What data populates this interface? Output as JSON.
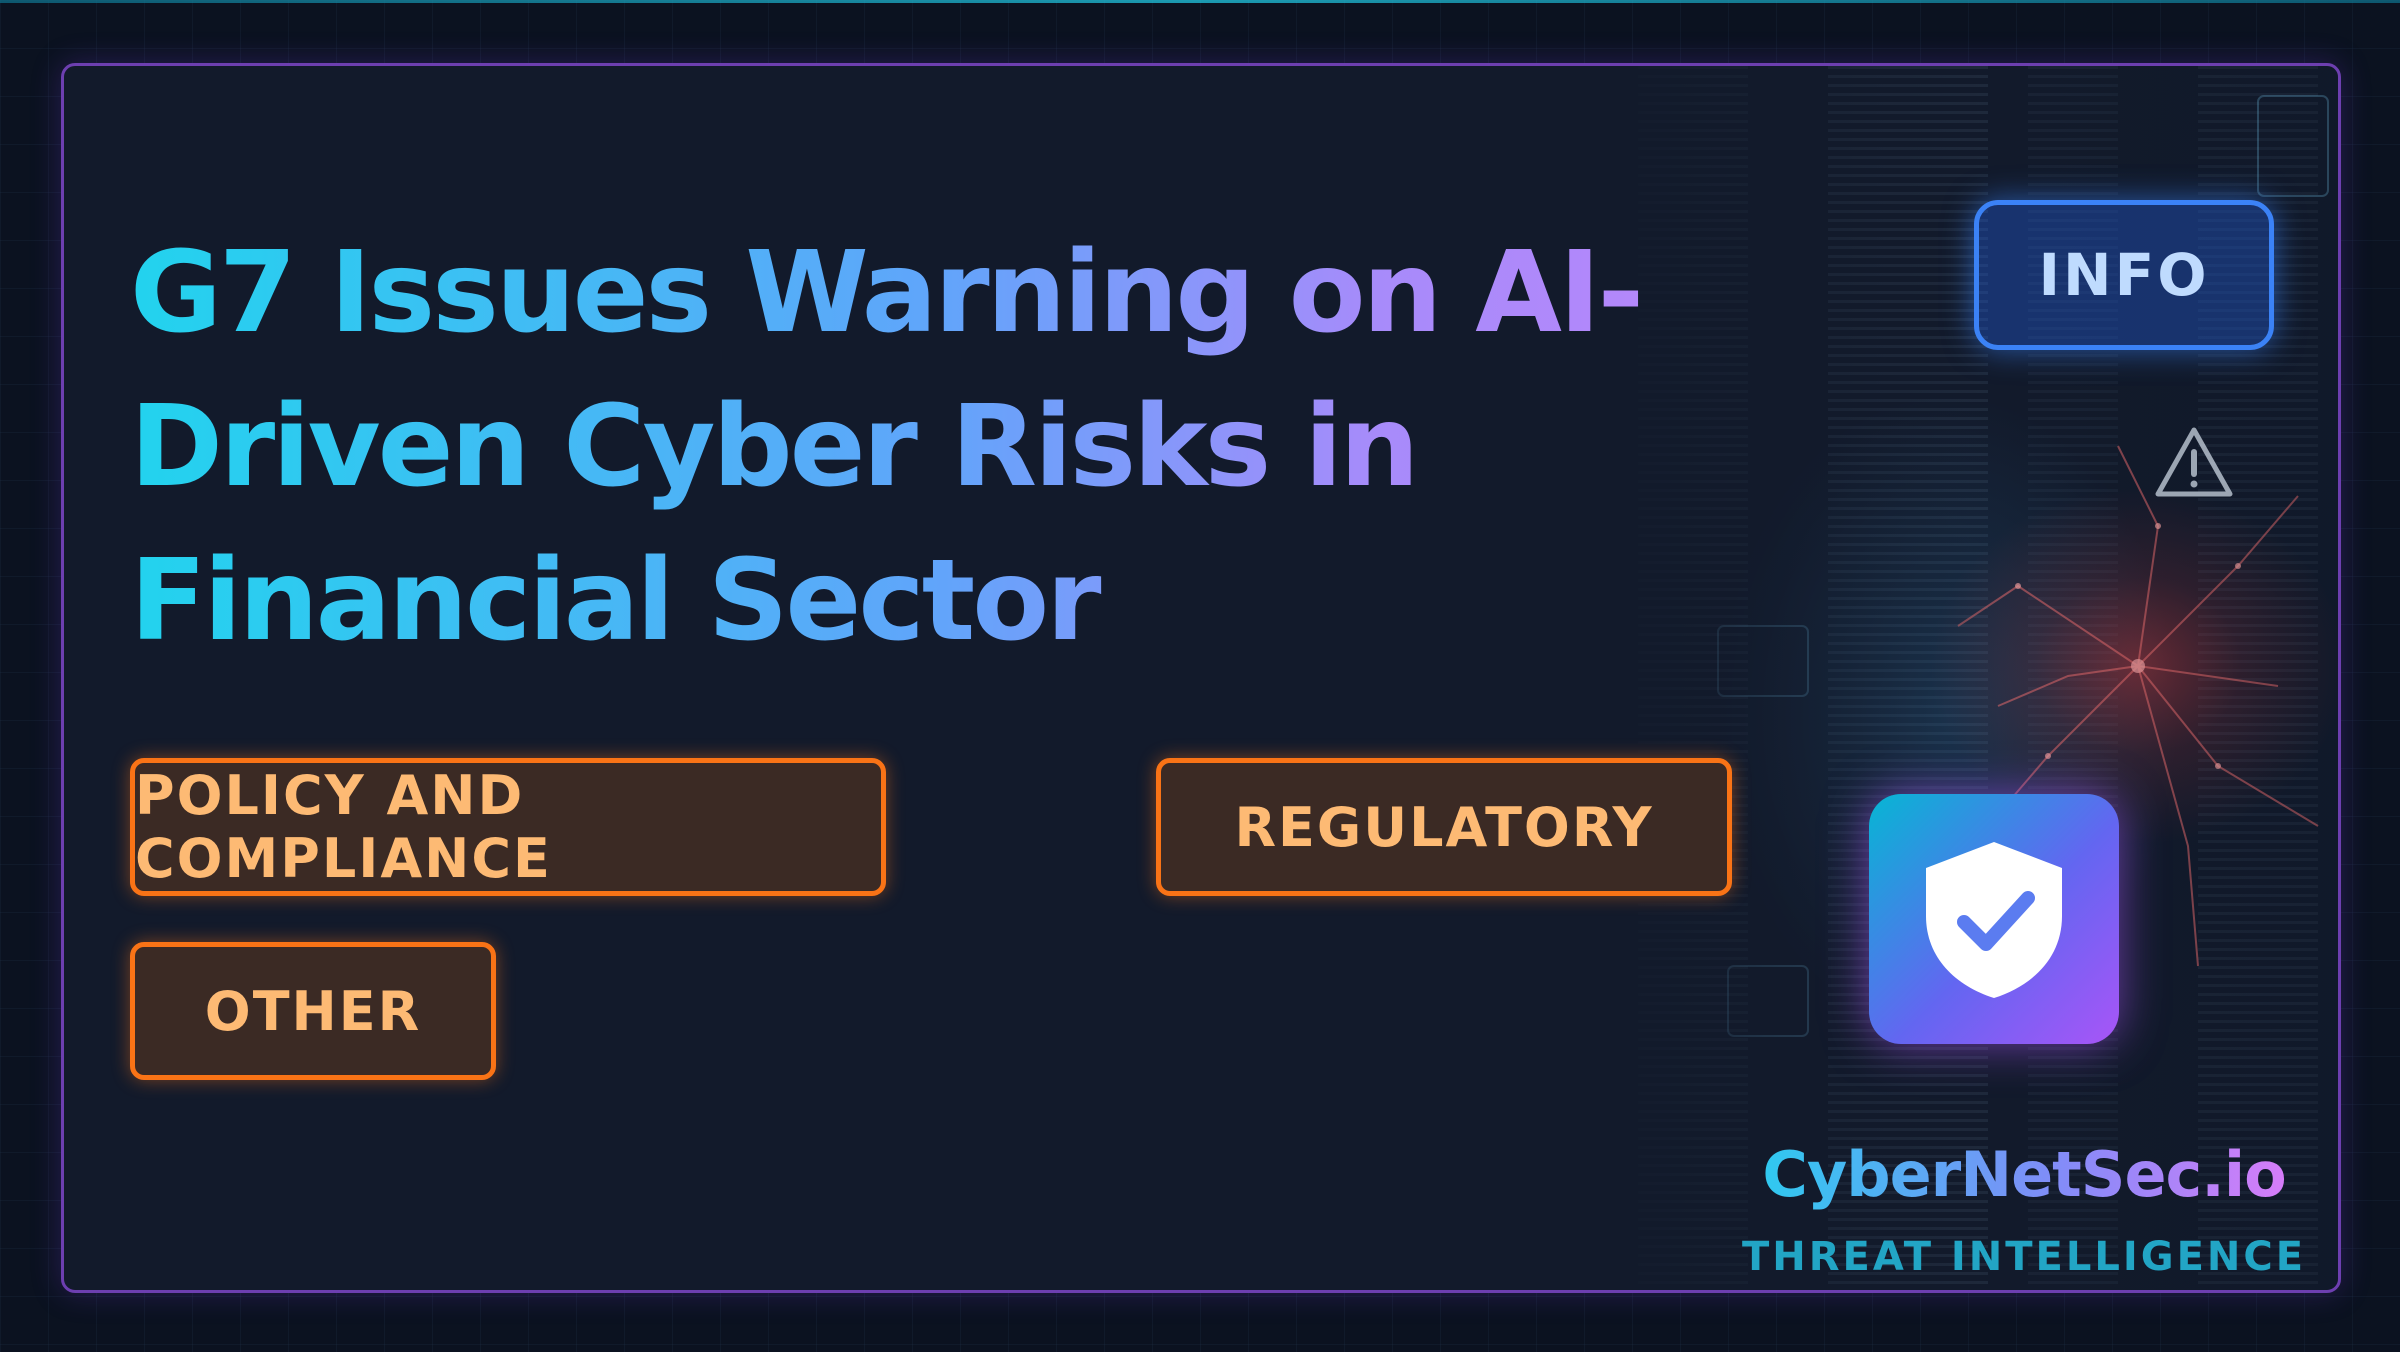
{
  "headline": {
    "line1": "G7 Issues Warning on AI-",
    "line2": "Driven Cyber Risks in",
    "line3": "Financial Sector"
  },
  "tags": [
    {
      "label": "POLICY AND COMPLIANCE"
    },
    {
      "label": "REGULATORY"
    },
    {
      "label": "OTHER"
    }
  ],
  "severity_badge": {
    "label": "INFO",
    "color": "#3b82f6"
  },
  "brand": {
    "name": "CyberNetSec.io",
    "tagline": "THREAT INTELLIGENCE",
    "icon": "shield-check-icon"
  },
  "colors": {
    "card_border": "#6d3fb0",
    "tag_border": "#f97316",
    "tag_text": "#fdba74",
    "headline_start": "#22d3ee",
    "headline_end": "#c084fc"
  }
}
